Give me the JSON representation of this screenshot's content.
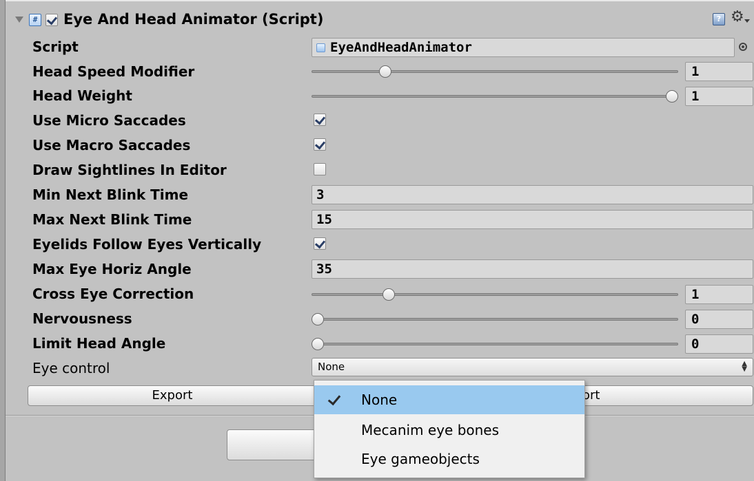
{
  "component": {
    "title": "Eye And Head Animator (Script)",
    "enabled": true
  },
  "rows": {
    "script": {
      "label": "Script",
      "value": "EyeAndHeadAnimator"
    },
    "head_speed_modifier": {
      "label": "Head Speed Modifier",
      "value": "1",
      "fraction": 0.19
    },
    "head_weight": {
      "label": "Head Weight",
      "value": "1",
      "fraction": 1.0
    },
    "use_micro_saccades": {
      "label": "Use Micro Saccades",
      "checked": true
    },
    "use_macro_saccades": {
      "label": "Use Macro Saccades",
      "checked": true
    },
    "draw_sightlines": {
      "label": "Draw Sightlines In Editor",
      "checked": false
    },
    "min_next_blink_time": {
      "label": "Min Next Blink Time",
      "value": "3"
    },
    "max_next_blink_time": {
      "label": "Max Next Blink Time",
      "value": "15"
    },
    "eyelids_follow": {
      "label": "Eyelids Follow Eyes Vertically",
      "checked": true
    },
    "max_eye_horiz_angle": {
      "label": "Max Eye Horiz Angle",
      "value": "35"
    },
    "cross_eye_correction": {
      "label": "Cross Eye Correction",
      "value": "1",
      "fraction": 0.2
    },
    "nervousness": {
      "label": "Nervousness",
      "value": "0",
      "fraction": 0.0
    },
    "limit_head_angle": {
      "label": "Limit Head Angle",
      "value": "0",
      "fraction": 0.0
    },
    "eye_control": {
      "label": "Eye control",
      "value": "None"
    }
  },
  "buttons": {
    "export": "Export",
    "import_partial": "ort"
  },
  "dropdown": {
    "options": [
      "None",
      "Mecanim eye bones",
      "Eye gameobjects"
    ],
    "selected_index": 0
  },
  "colors": {
    "panel": "#c2c2c2",
    "selection": "#99c9ef"
  },
  "icons": {
    "component": "script-icon",
    "help": "help-icon",
    "settings": "gear-icon",
    "object_picker": "picker-icon"
  }
}
